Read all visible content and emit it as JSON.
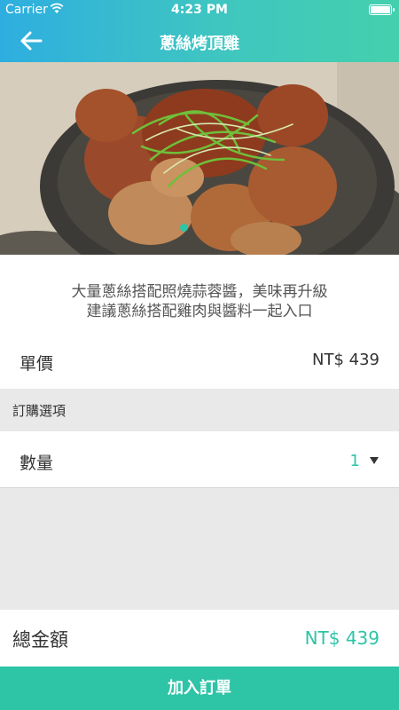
{
  "status_bar": {
    "carrier": "Carrier",
    "time": "4:23 PM"
  },
  "nav": {
    "title": "蔥絲烤頂雞",
    "back_icon": "arrow-left-icon"
  },
  "hero": {
    "image_alt": "蔥絲烤頂雞 food photo",
    "page_indicator_color": "#2ec4a6"
  },
  "description": {
    "line1": "大量蔥絲搭配照燒蒜蓉醬，美味再升級",
    "line2": "建議蔥絲搭配雞肉與醬料一起入口"
  },
  "price": {
    "label": "單價",
    "value": "NT$ 439"
  },
  "options": {
    "section_title": "訂購選項",
    "quantity_label": "數量",
    "quantity_value": "1",
    "dropdown_icon": "caret-down-icon"
  },
  "total": {
    "label": "總金額",
    "value": "NT$ 439"
  },
  "cta": {
    "label": "加入訂單"
  },
  "colors": {
    "accent": "#2ec4a6",
    "header_start": "#2eaee0",
    "header_end": "#44d0ad"
  }
}
